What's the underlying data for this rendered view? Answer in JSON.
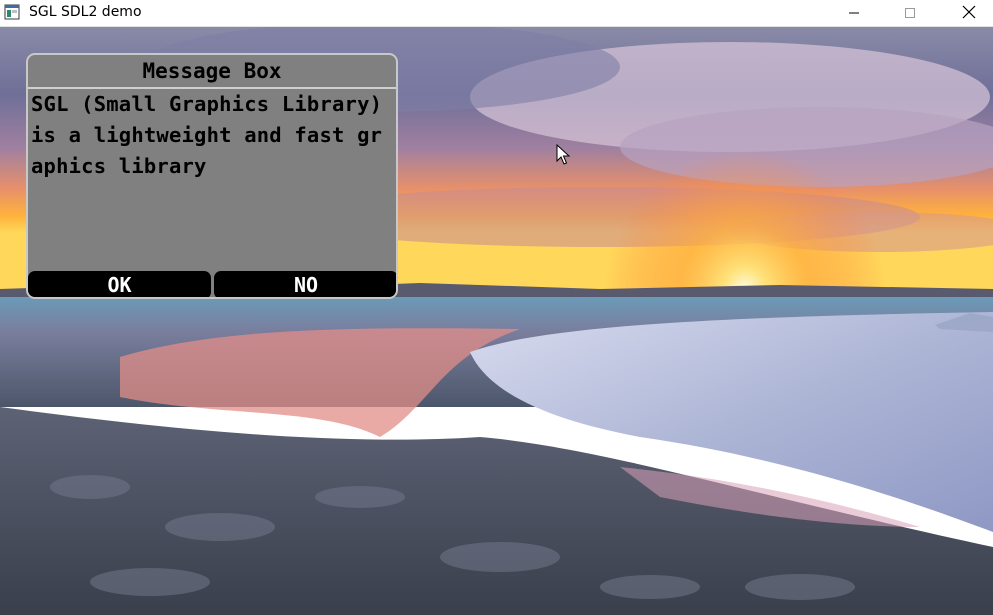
{
  "window": {
    "title": "SGL SDL2 demo",
    "app_icon": "window-icon",
    "controls": [
      "minimize-icon",
      "maximize-icon",
      "close-icon"
    ]
  },
  "message_box": {
    "title": "Message Box",
    "text": "SGL (Small Graphics Library) is a lightweight and fast graphics library",
    "ok_label": "OK",
    "no_label": "NO",
    "colors": {
      "panel": "#808080",
      "border": "#c8c8c8",
      "button": "#000000",
      "button_text": "#ffffff"
    }
  },
  "cursor": "mouse-pointer-icon"
}
